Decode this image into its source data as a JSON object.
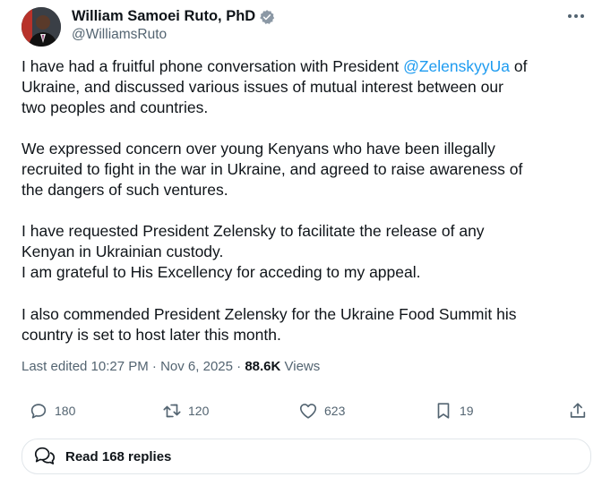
{
  "author": {
    "name": "William Samoei Ruto, PhD",
    "handle": "@WilliamsRuto"
  },
  "tweet": {
    "lines": [
      {
        "pre": "I have had a fruitful phone conversation with President ",
        "mention": "@ZelenskyyUa",
        "post": " of"
      },
      "Ukraine, and discussed various issues of mutual interest between our",
      "two peoples and countries.",
      "We expressed concern over young Kenyans who have been illegally",
      "recruited to fight in the war in Ukraine, and agreed to raise awareness of",
      "the dangers of such ventures.",
      "I have requested President Zelensky to facilitate the release of any",
      "Kenyan in Ukrainian custody.",
      "I am grateful to His Excellency for acceding to my appeal.",
      "I also commended President Zelensky for the Ukraine Food Summit his",
      "country is set to host later this month."
    ]
  },
  "meta": {
    "edited": "Last edited 10:27 PM · Nov 6, 2025 · ",
    "views_count": "88.6K",
    "views_label": " Views"
  },
  "actions": {
    "replies": "180",
    "reposts": "120",
    "likes": "623",
    "bookmarks": "19"
  },
  "read_replies_label": "Read 168 replies",
  "icons": [
    "verified-badge-icon",
    "more-icon",
    "reply-icon",
    "repost-icon",
    "like-icon",
    "bookmark-icon",
    "share-icon",
    "chat-bubbles-icon"
  ],
  "colors": {
    "accent": "#1d9bf0",
    "text": "#0f1419",
    "muted": "#536471"
  }
}
